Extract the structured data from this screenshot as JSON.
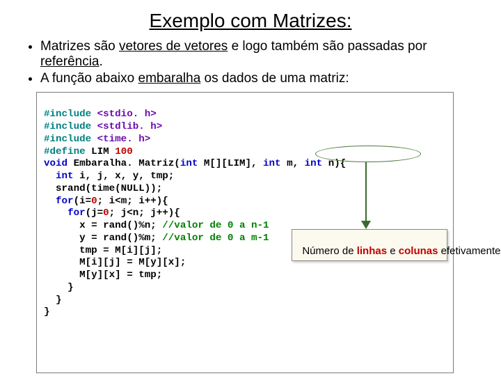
{
  "title": "Exemplo com Matrizes:",
  "bullets": {
    "b1_pre": "Matrizes são ",
    "b1_u1": "vetores de vetores",
    "b1_mid": " e logo também são passadas por ",
    "b1_u2": "referência",
    "b1_post": ".",
    "b2_pre": "A função abaixo ",
    "b2_u": "embaralha",
    "b2_post": " os dados de uma matriz:"
  },
  "code": {
    "l1a": "#include ",
    "l1b": "<stdio. h>",
    "l2a": "#include ",
    "l2b": "<stdlib. h>",
    "l3a": "#include ",
    "l3b": "<time. h>",
    "l4a": "#define ",
    "l4b": "LIM ",
    "l4c": "100",
    "l5a": "void",
    "l5b": " Embaralha. Matriz(",
    "l5c": "int",
    "l5d": " M[][LIM], ",
    "l5e": "int",
    "l5f": " m, ",
    "l5g": "int",
    "l5h": " n){",
    "l6a": "  ",
    "l6b": "int",
    "l6c": " i, j, x, y, tmp;",
    "l7": "  srand(time(NULL));",
    "l8a": "  ",
    "l8b": "for",
    "l8c": "(i=",
    "l8d": "0",
    "l8e": "; i<m; i++){",
    "l9a": "    ",
    "l9b": "for",
    "l9c": "(j=",
    "l9d": "0",
    "l9e": "; j<n; j++){",
    "l10a": "      x = rand()%n; ",
    "l10b": "//valor de 0 a n-1",
    "l11a": "      y = rand()%m; ",
    "l11b": "//valor de 0 a m-1",
    "l12": "      tmp = M[i][j];",
    "l13": "      M[i][j] = M[y][x];",
    "l14": "      M[y][x] = tmp;",
    "l15": "    }",
    "l16": "  }",
    "l17": "}"
  },
  "callout": {
    "p1": "Número de ",
    "p2": "linhas",
    "p3": " e ",
    "p4": "colunas",
    "p5": " efetivamente em uso."
  }
}
